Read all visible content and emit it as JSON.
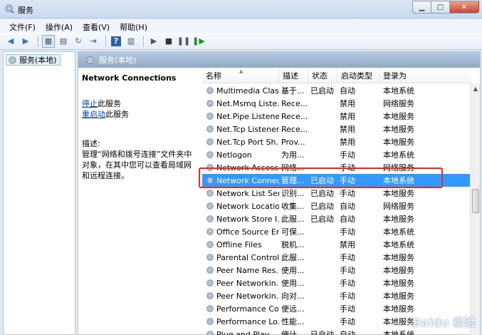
{
  "window": {
    "title": "服务"
  },
  "menu": [
    "文件(F)",
    "操作(A)",
    "查看(V)",
    "帮助(H)"
  ],
  "tree": {
    "root_label": "服务(本地)"
  },
  "pane": {
    "header": "服务(本地)",
    "selected_service": "Network Connections",
    "stop_link": "停止",
    "stop_suffix": "此服务",
    "restart_link": "重启动",
    "restart_suffix": "此服务",
    "desc_label": "描述:",
    "desc_text": "管理“网络和拨号连接”文件夹中对象，在其中您可以查看局域网和远程连接。"
  },
  "columns": {
    "name": "名称",
    "desc": "描述",
    "status": "状态",
    "start": "启动类型",
    "logon": "登录为"
  },
  "rows": [
    {
      "name": "Multimedia Clas...",
      "desc": "基于...",
      "status": "已启动",
      "start": "自动",
      "logon": "本地系统"
    },
    {
      "name": "Net.Msmq Liste...",
      "desc": "Rece...",
      "status": "",
      "start": "禁用",
      "logon": "网络服务"
    },
    {
      "name": "Net.Pipe Listene...",
      "desc": "Rece...",
      "status": "",
      "start": "禁用",
      "logon": "本地服务"
    },
    {
      "name": "Net.Tcp Listener...",
      "desc": "Rece...",
      "status": "",
      "start": "禁用",
      "logon": "本地服务"
    },
    {
      "name": "Net.Tcp Port Sh...",
      "desc": "Prov...",
      "status": "",
      "start": "禁用",
      "logon": "本地服务"
    },
    {
      "name": "Netlogon",
      "desc": "为用...",
      "status": "",
      "start": "手动",
      "logon": "本地系统"
    },
    {
      "name": "Network Access...",
      "desc": "网络...",
      "status": "",
      "start": "手动",
      "logon": "网络服务"
    },
    {
      "name": "Network Connec...",
      "desc": "管理...",
      "status": "已启动",
      "start": "手动",
      "logon": "本地系统"
    },
    {
      "name": "Network List Ser...",
      "desc": "识别...",
      "status": "已启动",
      "start": "手动",
      "logon": "本地服务"
    },
    {
      "name": "Network Locatio...",
      "desc": "收集...",
      "status": "已启动",
      "start": "自动",
      "logon": "网络服务"
    },
    {
      "name": "Network Store I...",
      "desc": "此服...",
      "status": "已启动",
      "start": "自动",
      "logon": "本地服务"
    },
    {
      "name": "Office Source En...",
      "desc": "可保...",
      "status": "",
      "start": "手动",
      "logon": "本地系统"
    },
    {
      "name": "Offline Files",
      "desc": "脱机...",
      "status": "",
      "start": "禁用",
      "logon": "本地系统"
    },
    {
      "name": "Parental Controls",
      "desc": "此服...",
      "status": "",
      "start": "手动",
      "logon": "本地服务"
    },
    {
      "name": "Peer Name Res...",
      "desc": "使用...",
      "status": "",
      "start": "手动",
      "logon": "本地服务"
    },
    {
      "name": "Peer Networkin...",
      "desc": "使用...",
      "status": "",
      "start": "手动",
      "logon": "本地服务"
    },
    {
      "name": "Peer Networkin...",
      "desc": "向对...",
      "status": "",
      "start": "手动",
      "logon": "本地服务"
    },
    {
      "name": "Performance Co...",
      "desc": "使远...",
      "status": "",
      "start": "手动",
      "logon": "本地服务"
    },
    {
      "name": "Performance Lo...",
      "desc": "性能...",
      "status": "",
      "start": "手动",
      "logon": "本地服务"
    },
    {
      "name": "Plug and Play",
      "desc": "使计...",
      "status": "已启动",
      "start": "自动",
      "logon": "本地系统"
    }
  ],
  "selected_index": 7,
  "watermark": "Baidu 经验",
  "colors": {
    "selection": "#3399ff",
    "highlight_box": "#e52b2b",
    "header": "#8ea9c7"
  }
}
